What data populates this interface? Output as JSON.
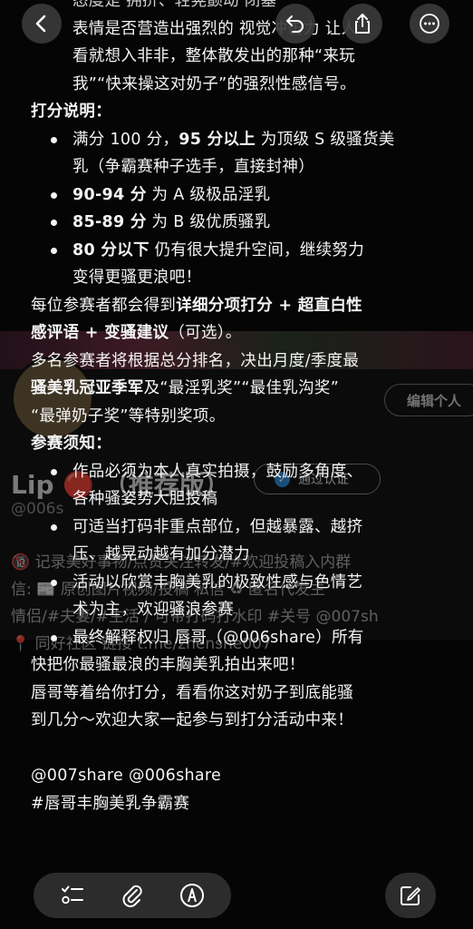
{
  "underlay": {
    "edit_button": "编辑个人",
    "name": "Lip 🔴 （推荐版）",
    "badge": "通过认证",
    "handle": "@006s",
    "bio_lines": [
      "🔞 记录美好事物/点赞关注转发/#欢迎投稿入内群",
      "信: 📰 原创图片视频/投稿 私信 ♻ 匿名代发主",
      "情侣/#夫妻/#生活 / 可带打码打水印 #关号 @007sh",
      "📍 同好社区 链接 t.me/zhenshe007"
    ]
  },
  "post": {
    "line_top_1": "态度是 拥挤、轻晃颤动 闭塞",
    "line_top_2": "表情是否营造出强烈的 视觉冲击力 让人",
    "line_top_3": "看就想入非非，整体散发出的那种“来玩",
    "line_top_4": "我”“快来操这对奶子”的强烈性感信号。",
    "scoring_heading": "打分说明：",
    "scoring": [
      {
        "lines": [
          [
            "满分 100 分，",
            ""
          ],
          [
            "95 分以上",
            "b"
          ],
          [
            " 为顶级 S 级骚货美",
            ""
          ]
        ],
        "cont": "乳（争霸赛种子选手，直接封神）"
      },
      {
        "lines": [
          [
            "90-94 分",
            "b"
          ],
          [
            " 为 A 级极品淫乳",
            ""
          ]
        ],
        "cont": ""
      },
      {
        "lines": [
          [
            "85-89 分",
            "b"
          ],
          [
            " 为 B 级优质骚乳",
            ""
          ]
        ],
        "cont": ""
      },
      {
        "lines": [
          [
            "80 分以下",
            "b"
          ],
          [
            " 仍有很大提升空间，继续努力",
            ""
          ]
        ],
        "cont": "变得更骚更浪吧！"
      }
    ],
    "para1_line1_pre": "每位参赛者都会得到",
    "para1_line1_b": "详细分项打分 + 超直白性",
    "para1_line2_b": "感评语 + 变骚建议",
    "para1_line2_post": "（可选）。",
    "para2_line1": "多名参赛者将根据总分排名，决出月度/季度最",
    "para2_line2_b": "骚美乳冠亚季军",
    "para2_line2_post": "及“最淫乳奖”“最佳乳沟奖”",
    "para2_line3": "“最弹奶子奖”等特别奖项。",
    "rules_heading": "参赛须知：",
    "rules": [
      {
        "line": "作品必须为本人真实拍摄，鼓励多角度、",
        "cont": "各种骚姿势大胆投稿"
      },
      {
        "line": "可适当打码非重点部位，但越暴露、越挤",
        "cont": "压、越晃动越有加分潜力"
      },
      {
        "line": "活动以欣赏丰胸美乳的极致性感与色情艺",
        "cont": "术为主，欢迎骚浪参赛"
      },
      {
        "line": "最终解释权归 唇哥（@006share）所有",
        "cont": ""
      }
    ],
    "closing_1": "快把你最骚最浪的丰胸美乳拍出来吧！",
    "closing_2": "唇哥等着给你打分，看看你这对奶子到底能骚",
    "closing_3": "到几分～欢迎大家一起参与到打分活动中来！",
    "mentions": "@007share @006share",
    "hashtag": "#唇哥丰胸美乳争霸赛"
  },
  "icons": {
    "back": "chevron-left-icon",
    "undo": "undo-icon",
    "share": "share-icon",
    "more": "more-icon",
    "checklist": "checklist-icon",
    "attach": "paperclip-icon",
    "markup": "markup-pen-icon",
    "compose": "compose-icon"
  }
}
